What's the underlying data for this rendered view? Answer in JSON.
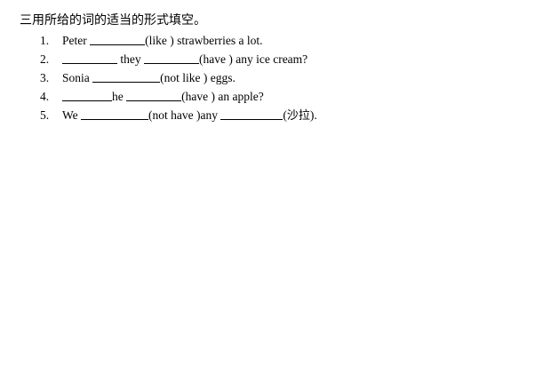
{
  "heading": "三用所给的词的适当的形式填空。",
  "items": [
    {
      "number": "1.",
      "parts": [
        "Peter ",
        "",
        "(like ) strawberries a lot."
      ]
    },
    {
      "number": "2.",
      "parts": [
        "",
        "",
        " they ",
        "",
        "(have ) any ice cream?"
      ]
    },
    {
      "number": "3.",
      "parts": [
        "Sonia ",
        "",
        "(not like ) eggs."
      ]
    },
    {
      "number": "4.",
      "parts": [
        "",
        "he ",
        "",
        "(have ) an apple?"
      ]
    },
    {
      "number": "5.",
      "parts": [
        "We ",
        "",
        "(not have )any ",
        "",
        "(",
        "沙拉",
        ")."
      ]
    }
  ]
}
